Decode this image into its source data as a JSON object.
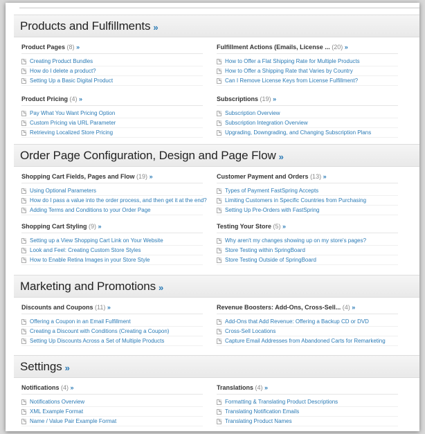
{
  "sections": [
    {
      "title": "Products and Fulfillments",
      "categories": [
        {
          "name": "Product Pages",
          "count": "(8)",
          "items": [
            "Creating Product Bundles",
            "How do I delete a product?",
            "Setting Up a Basic Digital Product"
          ]
        },
        {
          "name": "Fulfillment Actions (Emails, License ...",
          "count": "(20)",
          "items": [
            "How to Offer a Flat Shipping Rate for Multiple Products",
            "How to Offer a Shipping Rate that Varies by Country",
            "Can I Remove License Keys from License Fulfillment?"
          ]
        },
        {
          "name": "Product Pricing",
          "count": "(4)",
          "items": [
            "Pay What You Want Pricing Option",
            "Custom Pricing via URL Parameter",
            "Retrieving Localized Store Pricing"
          ]
        },
        {
          "name": "Subscriptions",
          "count": "(19)",
          "items": [
            "Subscription Overview",
            "Subscription Integration Overview",
            "Upgrading, Downgrading, and Changing Subscription Plans"
          ]
        }
      ]
    },
    {
      "title": "Order Page Configuration, Design and Page Flow",
      "categories": [
        {
          "name": "Shopping Cart Fields, Pages and Flow",
          "count": "(19)",
          "items": [
            "Using Optional Parameters",
            "How do I pass a value into the order process, and then get it at the end?",
            "Adding Terms and Conditions to your Order Page"
          ]
        },
        {
          "name": "Customer Payment and Orders",
          "count": "(13)",
          "items": [
            "Types of Payment FastSpring Accepts",
            "Limiting Customers in Specific Countries from Purchasing",
            "Setting Up Pre-Orders with FastSpring"
          ]
        },
        {
          "name": "Shopping Cart Styling",
          "count": "(9)",
          "items": [
            "Setting up a View Shopping Cart Link on Your Website",
            "Look and Feel: Creating Custom Store Styles",
            "How to Enable Retina Images in your Store Style"
          ]
        },
        {
          "name": "Testing Your Store",
          "count": "(5)",
          "items": [
            "Why aren't my changes showing up on my store's pages?",
            "Store Testing within SpringBoard",
            "Store Testing Outside of SpringBoard"
          ]
        }
      ]
    },
    {
      "title": "Marketing and Promotions",
      "categories": [
        {
          "name": "Discounts and Coupons",
          "count": "(11)",
          "items": [
            "Offering a Coupon in an Email Fulfillment",
            "Creating a Discount with Conditions (Creating a Coupon)",
            "Setting Up Discounts Across a Set of Multiple Products"
          ]
        },
        {
          "name": "Revenue Boosters: Add-Ons, Cross-Sell...",
          "count": "(4)",
          "items": [
            "Add-Ons that Add Revenue: Offering a Backup CD or DVD",
            "Cross-Sell Locations",
            "Capture Email Addresses from Abandoned Carts for Remarketing"
          ]
        }
      ]
    },
    {
      "title": "Settings",
      "categories": [
        {
          "name": "Notifications",
          "count": "(4)",
          "items": [
            "Notifications Overview",
            "XML Example Format",
            "Name / Value Pair Example Format"
          ]
        },
        {
          "name": "Translations",
          "count": "(4)",
          "items": [
            "Formatting & Translating Product Descriptions",
            "Translating Notification Emails",
            "Translating Product Names"
          ]
        }
      ]
    }
  ],
  "raquo": "»"
}
